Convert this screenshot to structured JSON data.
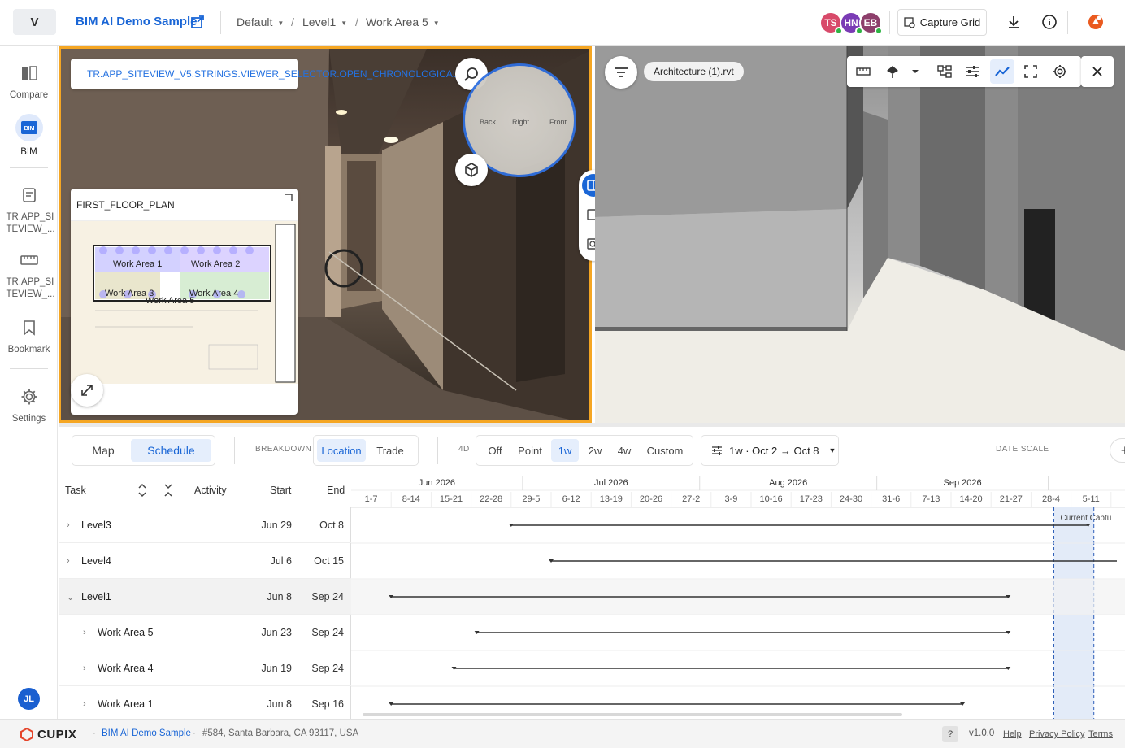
{
  "topbar": {
    "logo": "V",
    "project_title": "BIM AI Demo Sample",
    "breadcrumb": [
      "Default",
      "Level1",
      "Work Area 5"
    ],
    "avatars": [
      {
        "initials": "TS",
        "color": "#d84a6a"
      },
      {
        "initials": "HN",
        "color": "#7a3bb5"
      },
      {
        "initials": "EB",
        "color": "#8d3f6b"
      }
    ],
    "capture_grid_label": "Capture Grid"
  },
  "sidebar": {
    "items": [
      {
        "label": "Compare",
        "icon": "compare-icon"
      },
      {
        "label": "BIM",
        "icon": "bim-icon",
        "active": true
      },
      {
        "label": "TR.APP_SI TEVIEW_...",
        "icon": "notes-icon"
      },
      {
        "label": "TR.APP_SI TEVIEW_...",
        "icon": "ruler-icon"
      },
      {
        "label": "Bookmark",
        "icon": "bookmark-icon"
      },
      {
        "label": "Settings",
        "icon": "gear-icon"
      }
    ],
    "user_initials": "JL"
  },
  "viewer_left": {
    "chrono_text": "TR.APP_SITEVIEW_V5.STRINGS.VIEWER_SELECTOR.OPEN_CHRONOLOGICAL",
    "compass": {
      "left": "Back",
      "center": "Right",
      "right": "Front"
    },
    "minimap_title": "FIRST_FLOOR_PLAN",
    "minimap_areas": [
      "Work Area 1",
      "Work Area 2",
      "Work Area 3",
      "Work Area 4",
      "Work Area 5"
    ]
  },
  "viewer_right": {
    "model_chip": "Architecture (1).rvt"
  },
  "schedule": {
    "tabs": [
      "Map",
      "Schedule"
    ],
    "active_tab": "Schedule",
    "breakdown_label": "BREAKDOWN",
    "breakdown_options": [
      "Location",
      "Trade"
    ],
    "breakdown_active": "Location",
    "fourd_label": "4D",
    "fourd_options": [
      "Off",
      "Point",
      "1w",
      "2w",
      "4w",
      "Custom"
    ],
    "fourd_active": "1w",
    "range_label": "1w · Oct 2 → Oct 8",
    "date_scale_label": "DATE SCALE",
    "columns": {
      "task": "Task",
      "activity": "Activity",
      "start": "Start",
      "end": "End"
    },
    "months": [
      "Jun 2026",
      "Jul 2026",
      "Aug 2026",
      "Sep 2026"
    ],
    "weeks": [
      "1-7",
      "8-14",
      "15-21",
      "22-28",
      "29-5",
      "6-12",
      "13-19",
      "20-26",
      "27-2",
      "3-9",
      "10-16",
      "17-23",
      "24-30",
      "31-6",
      "7-13",
      "14-20",
      "21-27",
      "28-4",
      "5-11"
    ],
    "current_capture_label": "Current Captu",
    "rows": [
      {
        "name": "Level3",
        "start": "Jun 29",
        "end": "Oct 8",
        "expanded": false,
        "indent": 0
      },
      {
        "name": "Level4",
        "start": "Jul 6",
        "end": "Oct 15",
        "expanded": false,
        "indent": 0
      },
      {
        "name": "Level1",
        "start": "Jun 8",
        "end": "Sep 24",
        "expanded": true,
        "indent": 0
      },
      {
        "name": "Work Area 5",
        "start": "Jun 23",
        "end": "Sep 24",
        "expanded": false,
        "indent": 1
      },
      {
        "name": "Work Area 4",
        "start": "Jun 19",
        "end": "Sep 24",
        "expanded": false,
        "indent": 1
      },
      {
        "name": "Work Area 1",
        "start": "Jun 8",
        "end": "Sep 16",
        "expanded": false,
        "indent": 1
      }
    ]
  },
  "footer": {
    "brand": "CUPIX",
    "project_link": "BIM AI Demo Sample",
    "address": "#584, Santa Barbara, CA 93117, USA",
    "help_q": "?",
    "version": "v1.0.0",
    "links": [
      "Help",
      "Privacy Policy",
      "Terms"
    ]
  }
}
